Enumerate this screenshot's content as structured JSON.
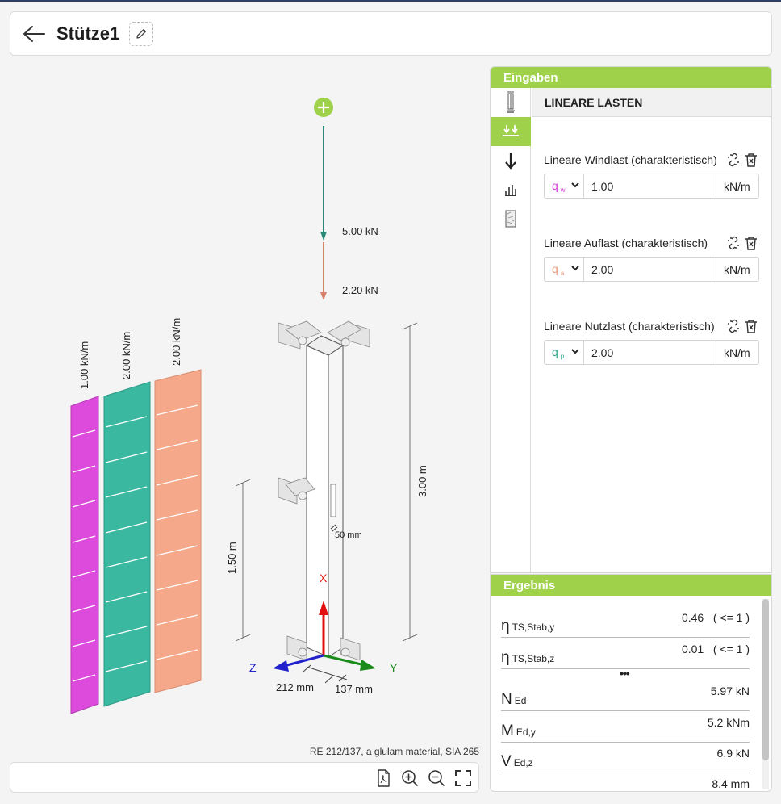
{
  "header": {
    "title": "Stütze1"
  },
  "diagram": {
    "point_loads": [
      "5.00 kN",
      "2.20 kN"
    ],
    "line_load_labels": [
      "1.00 kN/m",
      "2.00 kN/m",
      "2.00 kN/m"
    ],
    "dim_height": "3.00 m",
    "dim_mid": "1.50 m",
    "dim_offset": "50 mm",
    "dim_z": "212 mm",
    "dim_y": "137 mm",
    "axis_x": "X",
    "axis_y": "Y",
    "axis_z": "Z",
    "colors": {
      "wind": "#dd4bdc",
      "dead": "#3bb8a0",
      "live": "#f5a88a"
    }
  },
  "material_note": "RE 212/137, a glulam material, SIA 265",
  "inputs_panel": {
    "header": "Eingaben",
    "section_title": "LINEARE LASTEN",
    "loads": [
      {
        "label": "Lineare Windlast (charakteristisch)",
        "symbol": "q",
        "sub": "w",
        "value": "1.00",
        "unit": "kN/m",
        "color": "#d63cd6"
      },
      {
        "label": "Lineare Auflast (charakteristisch)",
        "symbol": "q",
        "sub": "a",
        "value": "2.00",
        "unit": "kN/m",
        "color": "#f0977a"
      },
      {
        "label": "Lineare Nutzlast (charakteristisch)",
        "symbol": "q",
        "sub": "p",
        "value": "2.00",
        "unit": "kN/m",
        "color": "#2aa88e"
      }
    ]
  },
  "results_panel": {
    "header": "Ergebnis",
    "more": "•••",
    "rows": [
      {
        "symbol": "η",
        "sub": "TS,Stab,y",
        "value": "0.46   ( <= 1 )"
      },
      {
        "symbol": "η",
        "sub": "TS,Stab,z",
        "value": "0.01   ( <= 1 )"
      },
      {
        "symbol": "N",
        "sub": "Ed",
        "value": "5.97 kN"
      },
      {
        "symbol": "M",
        "sub": "Ed,y",
        "value": "5.2 kNm"
      },
      {
        "symbol": "V",
        "sub": "Ed,z",
        "value": "6.9 kN"
      },
      {
        "symbol": "w",
        "sub": "",
        "value": "8.4 mm"
      }
    ]
  }
}
